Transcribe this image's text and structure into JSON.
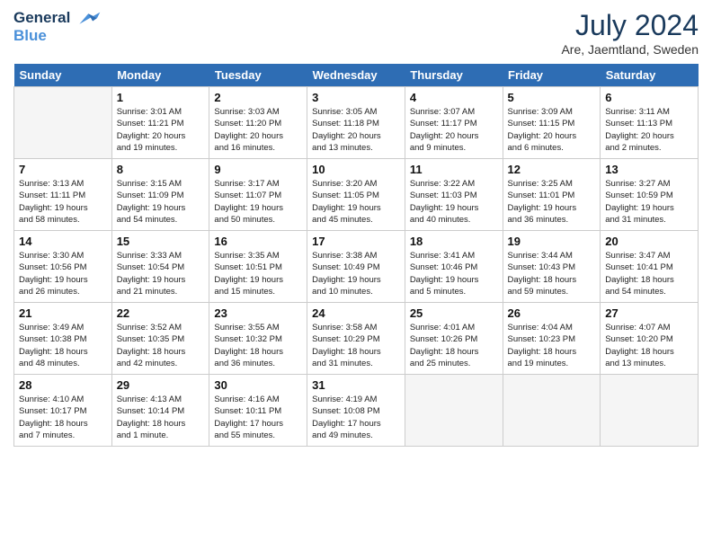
{
  "logo": {
    "line1": "General",
    "line2": "Blue"
  },
  "title": "July 2024",
  "location": "Are, Jaemtland, Sweden",
  "weekdays": [
    "Sunday",
    "Monday",
    "Tuesday",
    "Wednesday",
    "Thursday",
    "Friday",
    "Saturday"
  ],
  "weeks": [
    [
      {
        "day": "",
        "info": ""
      },
      {
        "day": "1",
        "info": "Sunrise: 3:01 AM\nSunset: 11:21 PM\nDaylight: 20 hours\nand 19 minutes."
      },
      {
        "day": "2",
        "info": "Sunrise: 3:03 AM\nSunset: 11:20 PM\nDaylight: 20 hours\nand 16 minutes."
      },
      {
        "day": "3",
        "info": "Sunrise: 3:05 AM\nSunset: 11:18 PM\nDaylight: 20 hours\nand 13 minutes."
      },
      {
        "day": "4",
        "info": "Sunrise: 3:07 AM\nSunset: 11:17 PM\nDaylight: 20 hours\nand 9 minutes."
      },
      {
        "day": "5",
        "info": "Sunrise: 3:09 AM\nSunset: 11:15 PM\nDaylight: 20 hours\nand 6 minutes."
      },
      {
        "day": "6",
        "info": "Sunrise: 3:11 AM\nSunset: 11:13 PM\nDaylight: 20 hours\nand 2 minutes."
      }
    ],
    [
      {
        "day": "7",
        "info": "Sunrise: 3:13 AM\nSunset: 11:11 PM\nDaylight: 19 hours\nand 58 minutes."
      },
      {
        "day": "8",
        "info": "Sunrise: 3:15 AM\nSunset: 11:09 PM\nDaylight: 19 hours\nand 54 minutes."
      },
      {
        "day": "9",
        "info": "Sunrise: 3:17 AM\nSunset: 11:07 PM\nDaylight: 19 hours\nand 50 minutes."
      },
      {
        "day": "10",
        "info": "Sunrise: 3:20 AM\nSunset: 11:05 PM\nDaylight: 19 hours\nand 45 minutes."
      },
      {
        "day": "11",
        "info": "Sunrise: 3:22 AM\nSunset: 11:03 PM\nDaylight: 19 hours\nand 40 minutes."
      },
      {
        "day": "12",
        "info": "Sunrise: 3:25 AM\nSunset: 11:01 PM\nDaylight: 19 hours\nand 36 minutes."
      },
      {
        "day": "13",
        "info": "Sunrise: 3:27 AM\nSunset: 10:59 PM\nDaylight: 19 hours\nand 31 minutes."
      }
    ],
    [
      {
        "day": "14",
        "info": "Sunrise: 3:30 AM\nSunset: 10:56 PM\nDaylight: 19 hours\nand 26 minutes."
      },
      {
        "day": "15",
        "info": "Sunrise: 3:33 AM\nSunset: 10:54 PM\nDaylight: 19 hours\nand 21 minutes."
      },
      {
        "day": "16",
        "info": "Sunrise: 3:35 AM\nSunset: 10:51 PM\nDaylight: 19 hours\nand 15 minutes."
      },
      {
        "day": "17",
        "info": "Sunrise: 3:38 AM\nSunset: 10:49 PM\nDaylight: 19 hours\nand 10 minutes."
      },
      {
        "day": "18",
        "info": "Sunrise: 3:41 AM\nSunset: 10:46 PM\nDaylight: 19 hours\nand 5 minutes."
      },
      {
        "day": "19",
        "info": "Sunrise: 3:44 AM\nSunset: 10:43 PM\nDaylight: 18 hours\nand 59 minutes."
      },
      {
        "day": "20",
        "info": "Sunrise: 3:47 AM\nSunset: 10:41 PM\nDaylight: 18 hours\nand 54 minutes."
      }
    ],
    [
      {
        "day": "21",
        "info": "Sunrise: 3:49 AM\nSunset: 10:38 PM\nDaylight: 18 hours\nand 48 minutes."
      },
      {
        "day": "22",
        "info": "Sunrise: 3:52 AM\nSunset: 10:35 PM\nDaylight: 18 hours\nand 42 minutes."
      },
      {
        "day": "23",
        "info": "Sunrise: 3:55 AM\nSunset: 10:32 PM\nDaylight: 18 hours\nand 36 minutes."
      },
      {
        "day": "24",
        "info": "Sunrise: 3:58 AM\nSunset: 10:29 PM\nDaylight: 18 hours\nand 31 minutes."
      },
      {
        "day": "25",
        "info": "Sunrise: 4:01 AM\nSunset: 10:26 PM\nDaylight: 18 hours\nand 25 minutes."
      },
      {
        "day": "26",
        "info": "Sunrise: 4:04 AM\nSunset: 10:23 PM\nDaylight: 18 hours\nand 19 minutes."
      },
      {
        "day": "27",
        "info": "Sunrise: 4:07 AM\nSunset: 10:20 PM\nDaylight: 18 hours\nand 13 minutes."
      }
    ],
    [
      {
        "day": "28",
        "info": "Sunrise: 4:10 AM\nSunset: 10:17 PM\nDaylight: 18 hours\nand 7 minutes."
      },
      {
        "day": "29",
        "info": "Sunrise: 4:13 AM\nSunset: 10:14 PM\nDaylight: 18 hours\nand 1 minute."
      },
      {
        "day": "30",
        "info": "Sunrise: 4:16 AM\nSunset: 10:11 PM\nDaylight: 17 hours\nand 55 minutes."
      },
      {
        "day": "31",
        "info": "Sunrise: 4:19 AM\nSunset: 10:08 PM\nDaylight: 17 hours\nand 49 minutes."
      },
      {
        "day": "",
        "info": ""
      },
      {
        "day": "",
        "info": ""
      },
      {
        "day": "",
        "info": ""
      }
    ]
  ]
}
